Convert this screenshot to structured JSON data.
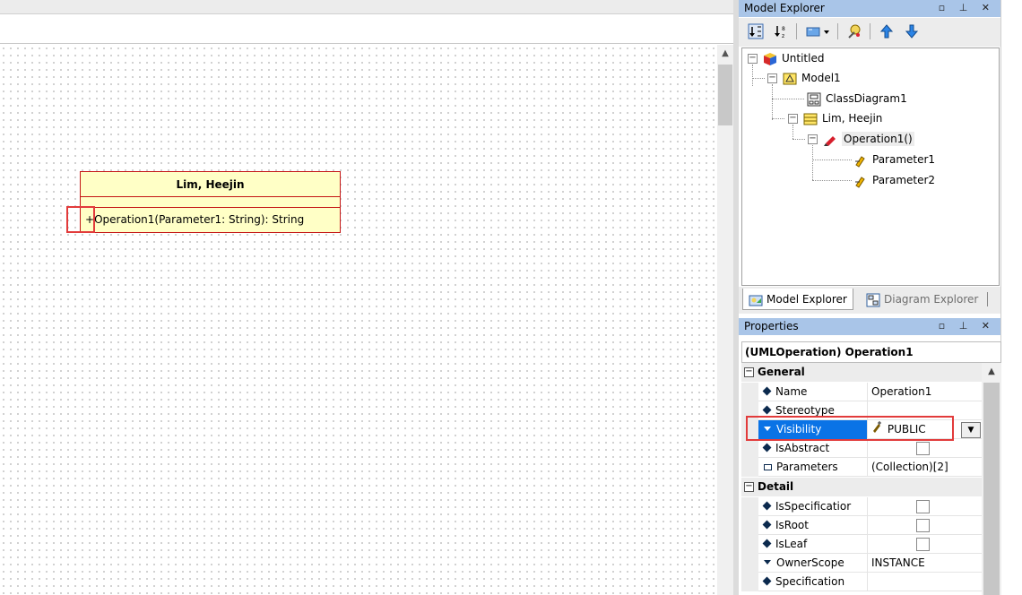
{
  "colors": {
    "panel_title_bg": "#a9c5e8",
    "class_fill": "#ffffc6",
    "class_border": "#c41515",
    "highlight": "#e23b3b",
    "selection": "#0a73e6"
  },
  "canvas": {
    "class_box": {
      "name": "Lim, Heejin",
      "visibility_symbol": "+",
      "operation": "Operation1(Parameter1: String): String"
    }
  },
  "model_explorer": {
    "title": "Model Explorer",
    "window_buttons": "▫ ⊥ ✕",
    "toolbar": [
      "sort-by-kind-icon",
      "sort-alphabetic-icon",
      "view-menu-icon",
      "filter-icon",
      "move-up-icon",
      "move-down-icon"
    ],
    "tree": [
      {
        "label": "Untitled",
        "icon": "project-icon",
        "expander": "−"
      },
      {
        "label": "Model1",
        "icon": "model-icon",
        "expander": "−"
      },
      {
        "label": "ClassDiagram1",
        "icon": "class-diagram-icon"
      },
      {
        "label": "Lim, Heejin",
        "icon": "class-icon",
        "expander": "−"
      },
      {
        "label": "Operation1()",
        "icon": "operation-icon",
        "expander": "−"
      },
      {
        "label": "Parameter1",
        "icon": "parameter-icon"
      },
      {
        "label": "Parameter2",
        "icon": "parameter-icon"
      }
    ],
    "tabs": [
      {
        "label": "Model Explorer",
        "active": true
      },
      {
        "label": "Diagram Explorer",
        "active": false
      }
    ]
  },
  "properties": {
    "title": "Properties",
    "window_buttons": "▫ ⊥ ✕",
    "object_header": "(UMLOperation) Operation1",
    "categories": {
      "general": "General",
      "detail": "Detail"
    },
    "rows": {
      "name": {
        "label": "Name",
        "value": "Operation1"
      },
      "stereotype": {
        "label": "Stereotype",
        "value": ""
      },
      "visibility": {
        "label": "Visibility",
        "value": "PUBLIC"
      },
      "is_abstract": {
        "label": "IsAbstract",
        "checked": false
      },
      "parameters": {
        "label": "Parameters",
        "value": "(Collection)[2]"
      },
      "is_specification": {
        "label": "IsSpecificatior",
        "checked": false
      },
      "is_root": {
        "label": "IsRoot",
        "checked": false
      },
      "is_leaf": {
        "label": "IsLeaf",
        "checked": false
      },
      "owner_scope": {
        "label": "OwnerScope",
        "value": "INSTANCE"
      },
      "specification": {
        "label": "Specification",
        "value": ""
      }
    }
  }
}
